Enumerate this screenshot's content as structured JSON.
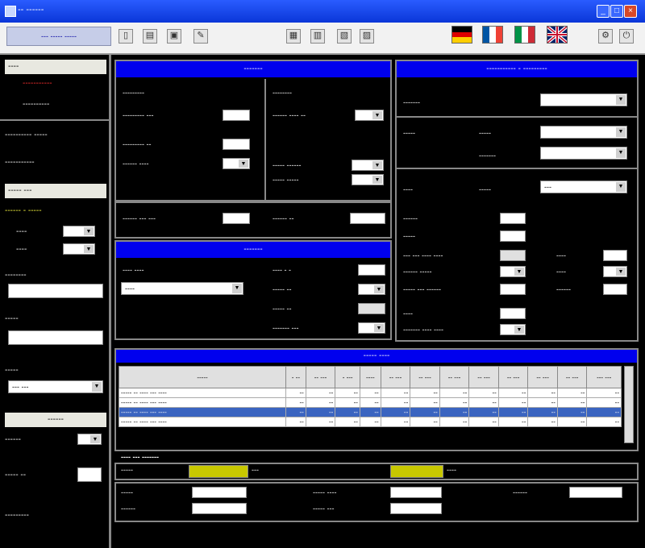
{
  "window": {
    "title": "-- ------"
  },
  "toolbar": {
    "user_tab_label": "--- ----- -----"
  },
  "flags": [
    {
      "name": "german-flag",
      "colors": [
        "#000000",
        "#dd0000",
        "#ffce00"
      ],
      "dir": "h"
    },
    {
      "name": "french-flag",
      "colors": [
        "#0055a4",
        "#ffffff",
        "#ef4135"
      ],
      "dir": "v"
    },
    {
      "name": "italian-flag",
      "colors": [
        "#009246",
        "#ffffff",
        "#ce2b37"
      ],
      "dir": "v"
    },
    {
      "name": "uk-flag",
      "colors": [
        "#012169",
        "#ffffff",
        "#c8102e"
      ],
      "dir": "uk"
    }
  ],
  "left": {
    "head1": "----",
    "opt1": "-----------",
    "opt2": "----------",
    "row1": "---------- -----",
    "row2": "-----------",
    "head2": "----- ---",
    "section_label": "------ - -----",
    "f1_label": "----",
    "f2_label": "----",
    "field3_label": "--------",
    "field4_label": "-----",
    "field5_label": "-----",
    "field5_value": "--- ---",
    "head3": "------",
    "f6_label": "------",
    "f7_label": "----- --",
    "bottom_label": "---------"
  },
  "calc": {
    "header": "-------",
    "sub_left": "---------",
    "sub_right": "--------",
    "l1": "--------- ---",
    "l2": "--------- --",
    "l3": "------ ----",
    "r1": "------ ---- --",
    "r2": "----- ------",
    "r3": "----- -----",
    "b1": "------ --- ---",
    "b2": "------ --"
  },
  "mid": {
    "header": "-------",
    "combo_label": "---- ----",
    "combo_value": "----",
    "l1": "---- - -",
    "l2": "----- --",
    "l3": "----- --",
    "l4": "------- ---"
  },
  "right": {
    "header": "----------- - ---------",
    "r1_label": "-------",
    "r2_label": "-----",
    "r2_sub1": "-----",
    "r2_sub2": "-------",
    "r3_label": "----",
    "r3_sub": "-----",
    "r3_value": "---",
    "rows": [
      "------",
      "-----",
      "--- --- ---- ----",
      "------ -----",
      "----- --- ------"
    ],
    "side": [
      "----",
      "----",
      "------"
    ],
    "b1": "----",
    "b2": "------- ---- ----"
  },
  "table": {
    "header": "----- ----",
    "columns": [
      "-----",
      "- --",
      "-- ---",
      "- ---",
      "----",
      "-- ---",
      "-- ---",
      "-- ---",
      "-- ---",
      "-- ---",
      "-- ---",
      "-- ---",
      "--- ---"
    ],
    "rows": [
      [
        "----- -- ---- --- ----",
        "--",
        "--",
        "--",
        "--",
        "--",
        "--",
        "--",
        "--",
        "--",
        "--",
        "--",
        "--"
      ],
      [
        "----- -- ---- --- ----",
        "--",
        "--",
        "--",
        "--",
        "--",
        "--",
        "--",
        "--",
        "--",
        "--",
        "--",
        "--"
      ],
      [
        "----- -- ---- --- ----",
        "--",
        "--",
        "--",
        "--",
        "--",
        "--",
        "--",
        "--",
        "--",
        "--",
        "--",
        "--"
      ],
      [
        "----- -- ---- --- ----",
        "--",
        "--",
        "--",
        "--",
        "--",
        "--",
        "--",
        "--",
        "--",
        "--",
        "--",
        "--"
      ]
    ],
    "selected_row": 2
  },
  "bottom": {
    "label": "---- --- -------",
    "bar1_label": "-----",
    "bar1_unit": "---",
    "bar2_unit": "----",
    "f1": "-----",
    "f2": "------",
    "f3": "----- ----",
    "f4": "----- ---",
    "f5": "------"
  },
  "colors": {
    "accent_blue": "#0000ee",
    "selected_row": "#3a64c0",
    "bar_yellow": "#c8c800"
  }
}
